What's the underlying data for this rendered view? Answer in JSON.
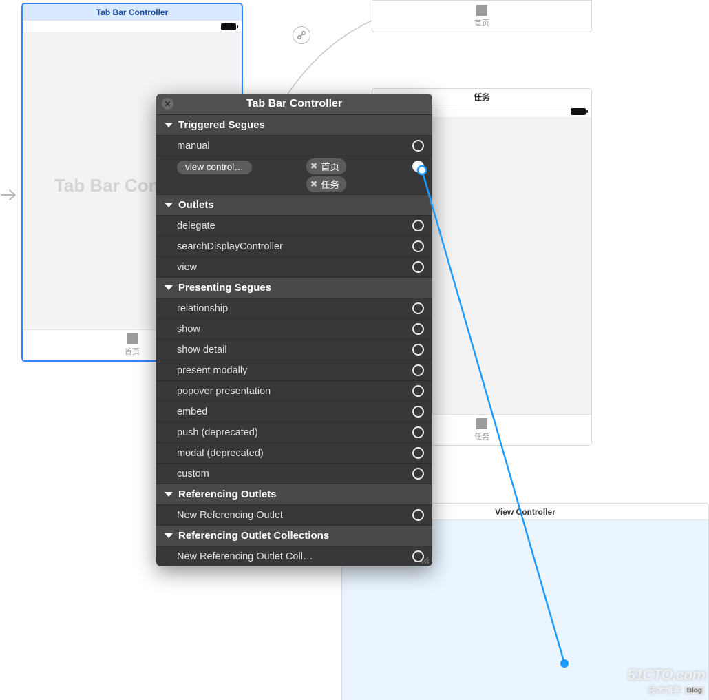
{
  "scenes": {
    "tabController": {
      "title": "Tab Bar Controller",
      "placeholder": "Tab Bar Controller",
      "tabs": [
        "首页"
      ]
    },
    "home": {
      "tab": "首页"
    },
    "tasks": {
      "title": "任务",
      "tab": "任务"
    },
    "viewController": {
      "title": "View Controller"
    }
  },
  "popover": {
    "title": "Tab Bar Controller",
    "sections": {
      "triggered": {
        "label": "Triggered Segues",
        "items": [
          "manual",
          "view control…"
        ],
        "connections": [
          "首页",
          "任务"
        ]
      },
      "outlets": {
        "label": "Outlets",
        "items": [
          "delegate",
          "searchDisplayController",
          "view"
        ]
      },
      "presenting": {
        "label": "Presenting Segues",
        "items": [
          "relationship",
          "show",
          "show detail",
          "present modally",
          "popover presentation",
          "embed",
          "push (deprecated)",
          "modal (deprecated)",
          "custom"
        ]
      },
      "refOutlets": {
        "label": "Referencing Outlets",
        "items": [
          "New Referencing Outlet"
        ]
      },
      "refOutletCol": {
        "label": "Referencing Outlet Collections",
        "items": [
          "New Referencing Outlet Coll…"
        ]
      }
    }
  },
  "watermark": {
    "line1": "51CTO.com",
    "line2": "技术博客",
    "badge": "Blog"
  }
}
